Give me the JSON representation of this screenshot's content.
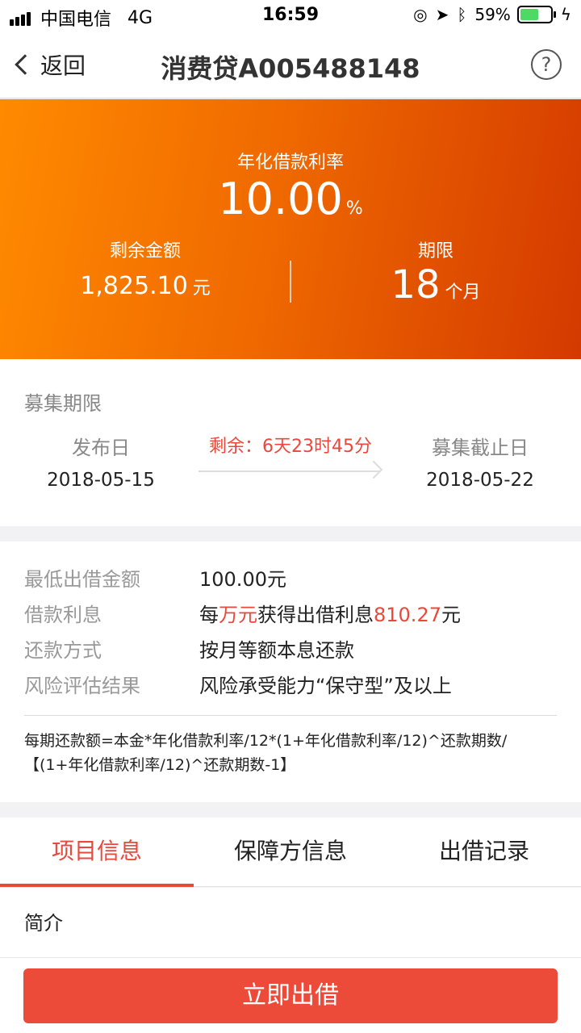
{
  "status_bar": {
    "carrier": "中国电信",
    "network": "4G",
    "time": "16:59",
    "battery": "59%",
    "icons": [
      "signal-icon",
      "lock-rotation-icon",
      "location-icon",
      "bluetooth-icon",
      "battery-icon",
      "charging-icon"
    ]
  },
  "nav": {
    "back_label": "返回",
    "title": "消费贷A005488148",
    "help_symbol": "?"
  },
  "hero": {
    "rate_label": "年化借款利率",
    "rate_value": "10.00",
    "rate_unit": "%",
    "remaining_label": "剩余金额",
    "remaining_value": "1,825.10",
    "remaining_unit": "元",
    "term_label": "期限",
    "term_value": "18",
    "term_unit": "个月"
  },
  "period": {
    "title": "募集期限",
    "publish_label": "发布日",
    "publish_date": "2018-05-15",
    "remaining_time": "剩余：6天23时45分",
    "deadline_label": "募集截止日",
    "deadline_date": "2018-05-22"
  },
  "info": {
    "min_label": "最低出借金额",
    "min_value": "100.00元",
    "interest_label": "借款利息",
    "interest_prefix": "每",
    "interest_unit_red": "万元",
    "interest_mid": "获得出借利息",
    "interest_amount": "810.27",
    "interest_suffix": "元",
    "repay_label": "还款方式",
    "repay_value": "按月等额本息还款",
    "risk_label": "风险评估结果",
    "risk_value": "风险承受能力“保守型”及以上",
    "formula": "每期还款额=本金*年化借款利率/12*(1+年化借款利率/12)^还款期数/【(1+年化借款利率/12)^还款期数-1】"
  },
  "tabs": {
    "project": "项目信息",
    "guarantor": "保障方信息",
    "records": "出借记录",
    "active": "项目信息"
  },
  "intro": {
    "title": "简介"
  },
  "action": {
    "lend_button": "立即出借"
  },
  "colors": {
    "accent_red": "#e9483a",
    "hero_start": "#ff8a00",
    "hero_end": "#d43a00",
    "battery_green": "#4cd964"
  }
}
